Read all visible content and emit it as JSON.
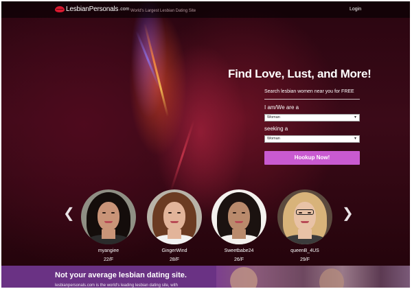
{
  "header": {
    "logo_text": "LesbianPersonals",
    "logo_tld": ".com",
    "tagline": "World's Largest Lesbian Dating Site",
    "login_label": "Login"
  },
  "hero": {
    "headline": "Find Love, Lust, and More!",
    "subhead": "Search lesbian women near you for FREE",
    "iam_label": "I am/We are a",
    "iam_value": "Woman",
    "seeking_label": "seeking a",
    "seeking_value": "Woman",
    "cta_label": "Hookup Now!"
  },
  "carousel": {
    "prev_icon": "chevron-left-icon",
    "next_icon": "chevron-right-icon",
    "profiles": [
      {
        "name": "myangiee",
        "age_gender": "22/F",
        "colors": {
          "bg": "#8f8f84",
          "hair": "#140d0b",
          "skin": "#c99478",
          "shirt": "#2b2b2b"
        }
      },
      {
        "name": "GingerWind",
        "age_gender": "28/F",
        "colors": {
          "bg": "#b8b3a8",
          "hair": "#6b3b22",
          "skin": "#e2b49a",
          "shirt": "#f2f2f2"
        }
      },
      {
        "name": "Sweetbabe24",
        "age_gender": "26/F",
        "colors": {
          "bg": "#f4f1ee",
          "hair": "#1b1210",
          "skin": "#b98a6c",
          "shirt": "#f4f1ee"
        }
      },
      {
        "name": "queenB_4US",
        "age_gender": "29/F",
        "colors": {
          "bg": "#5b4a3e",
          "hair": "#d8b37a",
          "skin": "#e8c2a6",
          "shirt": "#3b3b3b"
        }
      }
    ]
  },
  "band": {
    "title": "Not your average lesbian dating site.",
    "text": "lesbianpersonals.com is the world's leading lesbian dating site, with"
  },
  "colors": {
    "cta": "#c95ad0",
    "band": "#6a3284",
    "logo_lips": "#d9192f"
  }
}
